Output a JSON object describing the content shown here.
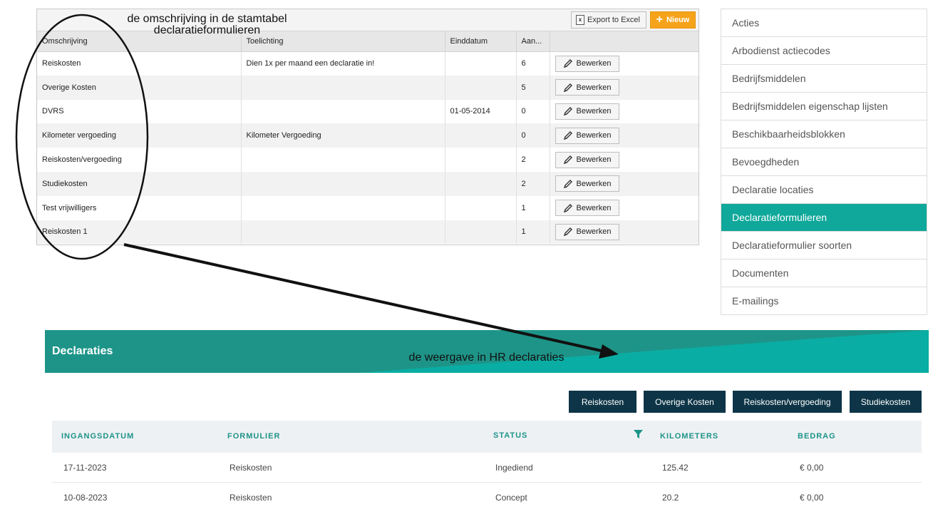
{
  "grid": {
    "toolbar": {
      "export_label": "Export to Excel",
      "new_label": "Nieuw"
    },
    "columns": [
      "Omschrijving",
      "Toelichting",
      "Einddatum",
      "Aan..."
    ],
    "edit_label": "Bewerken",
    "rows": [
      {
        "omschrijving": "Reiskosten",
        "toelichting": "Dien 1x per maand een declaratie in!",
        "einddatum": "",
        "aantal": "6"
      },
      {
        "omschrijving": "Overige Kosten",
        "toelichting": "",
        "einddatum": "",
        "aantal": "5"
      },
      {
        "omschrijving": "DVRS",
        "toelichting": "",
        "einddatum": "01-05-2014",
        "aantal": "0"
      },
      {
        "omschrijving": "Kilometer vergoeding",
        "toelichting": "Kilometer Vergoeding",
        "einddatum": "",
        "aantal": "0"
      },
      {
        "omschrijving": "Reiskosten/vergoeding",
        "toelichting": "",
        "einddatum": "",
        "aantal": "2"
      },
      {
        "omschrijving": "Studiekosten",
        "toelichting": "",
        "einddatum": "",
        "aantal": "2"
      },
      {
        "omschrijving": "Test vrijwilligers",
        "toelichting": "",
        "einddatum": "",
        "aantal": "1"
      },
      {
        "omschrijving": "Reiskosten 1",
        "toelichting": "",
        "einddatum": "",
        "aantal": "1"
      }
    ]
  },
  "side_menu": {
    "items": [
      "Acties",
      "Arbodienst actiecodes",
      "Bedrijfsmiddelen",
      "Bedrijfsmiddelen eigenschap lijsten",
      "Beschikbaarheidsblokken",
      "Bevoegdheden",
      "Declaratie locaties",
      "Declaratieformulieren",
      "Declaratieformulier soorten",
      "Documenten",
      "E-mailings"
    ],
    "active_item": "Declaratieformulieren"
  },
  "annotations": {
    "top_line1": "de omschrijving in de stamtabel",
    "top_line2": "declaratieformulieren",
    "bottom": "de weergave in HR declaraties"
  },
  "declaraties": {
    "title": "Declaraties",
    "filter_buttons": [
      "Reiskosten",
      "Overige Kosten",
      "Reiskosten/vergoeding",
      "Studiekosten"
    ],
    "columns": [
      "INGANGSDATUM",
      "FORMULIER",
      "STATUS",
      "KILOMETERS",
      "BEDRAG"
    ],
    "rows": [
      {
        "datum": "17-11-2023",
        "formulier": "Reiskosten",
        "status": "Ingediend",
        "kilometers": "125.42",
        "bedrag": "€ 0,00"
      },
      {
        "datum": "10-08-2023",
        "formulier": "Reiskosten",
        "status": "Concept",
        "kilometers": "20.2",
        "bedrag": "€ 0,00"
      }
    ]
  },
  "colors": {
    "accent": "#0fa89a",
    "banner": "#1e9488",
    "navy": "#0d3547",
    "orange": "#f5a31a"
  }
}
